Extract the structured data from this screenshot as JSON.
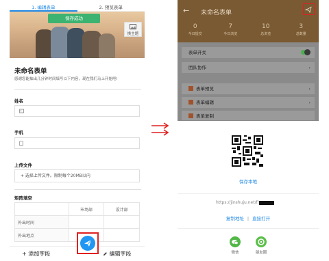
{
  "left_panel": {
    "tabs": [
      {
        "label": "1. 编辑表单"
      },
      {
        "label": "2. 预览表单"
      }
    ],
    "toast": "保存成功",
    "theme_button": "换主题",
    "form_title": "未命名表单",
    "form_desc": "感谢您能抽出几分钟时间填写以下内容，现在我们马上开始吧!",
    "fields": {
      "name_label": "姓名",
      "phone_label": "手机",
      "upload_label": "上传文件",
      "upload_hint": "+ 选择上传文件。限制每个20MB以内",
      "matrix_label": "矩阵填空"
    },
    "matrix": {
      "columns": [
        "市场部",
        "设计部"
      ],
      "rows": [
        "外出时间",
        "外出地点"
      ]
    },
    "bottom_bar": {
      "add_field": "+ 添加字段",
      "edit_field": "编辑字段"
    }
  },
  "right_panel": {
    "header_title": "未命名表单",
    "stats": [
      {
        "value": "0",
        "label": "今日提交"
      },
      {
        "value": "7",
        "label": "今日浏览"
      },
      {
        "value": "10",
        "label": "总浏览"
      },
      {
        "value": "3",
        "label": "总数量"
      }
    ],
    "menu": [
      {
        "label": "表单开关"
      },
      {
        "label": "团队协作"
      },
      {
        "label": "表单预览"
      },
      {
        "label": "表单编辑"
      },
      {
        "label": "表单复制"
      }
    ],
    "save_local": "保存本地",
    "url_prefix": "https://jinshuju.net/f/",
    "copy_link": "复制地址",
    "divider": "|",
    "open_link": "直接打开",
    "share_options": [
      {
        "label": "微信",
        "color": "#52b848"
      },
      {
        "label": "朋友圈",
        "color": "#5bbf4a"
      }
    ]
  },
  "colors": {
    "accent": "#1e88e5",
    "header_brown": "#7a5a33",
    "highlight_red": "#e02020"
  }
}
